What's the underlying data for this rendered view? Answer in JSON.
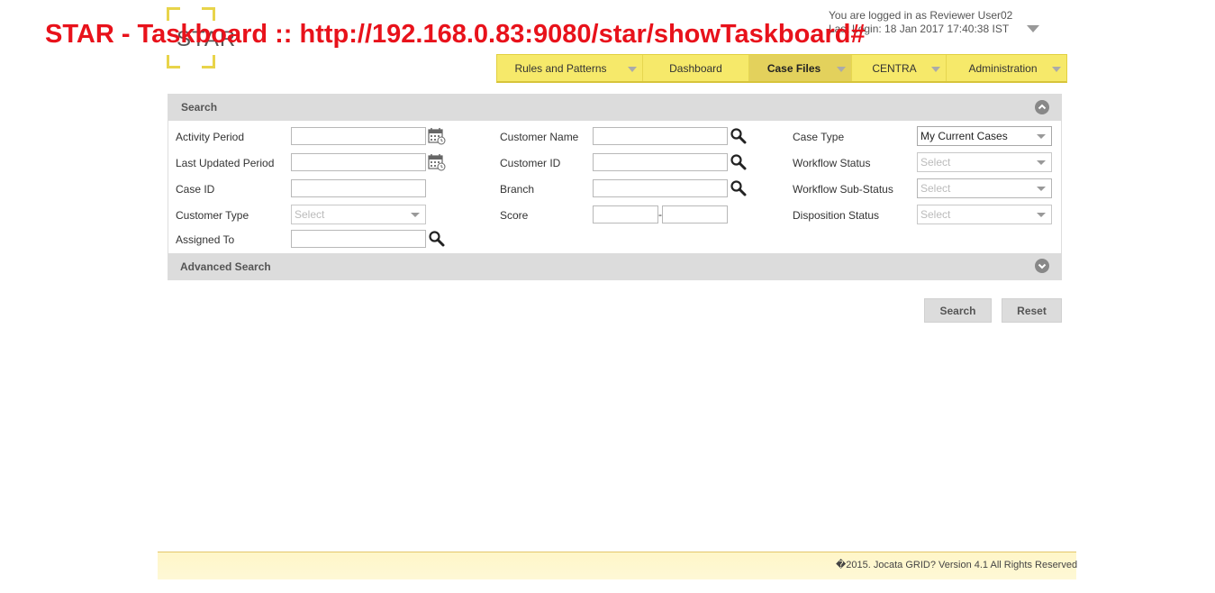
{
  "overlay_title": "STAR - Taskboard :: http://192.168.0.83:9080/star/showTaskboard#",
  "logo_text": "STAR",
  "user": {
    "logged_in": "You are logged in as Reviewer User02",
    "last_login": "Last Login: 18 Jan 2017 17:40:38 IST"
  },
  "nav": [
    {
      "label": "Rules and Patterns",
      "has_dropdown": true,
      "active": false
    },
    {
      "label": "Dashboard",
      "has_dropdown": false,
      "active": false
    },
    {
      "label": "Case Files",
      "has_dropdown": true,
      "active": true
    },
    {
      "label": "CENTRA",
      "has_dropdown": true,
      "active": false
    },
    {
      "label": "Administration",
      "has_dropdown": true,
      "active": false
    }
  ],
  "search": {
    "title": "Search",
    "labels": {
      "activity_period": "Activity Period",
      "last_updated_period": "Last Updated Period",
      "case_id": "Case ID",
      "customer_type": "Customer Type",
      "assigned_to": "Assigned To",
      "customer_name": "Customer Name",
      "customer_id": "Customer ID",
      "branch": "Branch",
      "score": "Score",
      "case_type": "Case Type",
      "workflow_status": "Workflow Status",
      "workflow_sub_status": "Workflow Sub-Status",
      "disposition_status": "Disposition Status"
    },
    "values": {
      "customer_type": "Select",
      "case_type": "My Current Cases",
      "workflow_status": "Select",
      "workflow_sub_status": "Select",
      "disposition_status": "Select",
      "score_separator": "-"
    }
  },
  "advanced_search_title": "Advanced Search",
  "buttons": {
    "search": "Search",
    "reset": "Reset"
  },
  "footer": "�2015. Jocata GRID? Version 4.1 All Rights Reserved",
  "colors": {
    "accent": "#f6e96a",
    "overlay": "#e8121b"
  }
}
